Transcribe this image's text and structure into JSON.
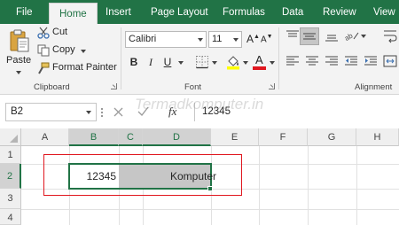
{
  "ribbon_tabs": [
    "File",
    "Home",
    "Insert",
    "Page Layout",
    "Formulas",
    "Data",
    "Review",
    "View"
  ],
  "clipboard": {
    "paste_label": "Paste",
    "cut_label": "Cut",
    "copy_label": "Copy",
    "format_painter_label": "Format Painter",
    "group_label": "Clipboard"
  },
  "font": {
    "font_name": "Calibri",
    "font_size": "11",
    "group_label": "Font",
    "bold": "B",
    "italic": "I",
    "underline": "U"
  },
  "alignment": {
    "group_label": "Alignment"
  },
  "formula_bar": {
    "name_box": "B2",
    "fx_label": "fx",
    "formula_value": "12345"
  },
  "sheet": {
    "columns": [
      "A",
      "B",
      "C",
      "D",
      "E",
      "F",
      "G",
      "H"
    ],
    "rows": [
      "1",
      "2",
      "3",
      "4"
    ],
    "cells": {
      "B2": "12345",
      "D2": "Komputer"
    }
  },
  "watermark": "Termadkomputer.in",
  "colors": {
    "excel_green": "#217346",
    "selection_gray": "#c6c6c6",
    "highlight_red": "#e0171f",
    "font_red": "#e0171f",
    "fill_yellow": "#ffff00"
  }
}
